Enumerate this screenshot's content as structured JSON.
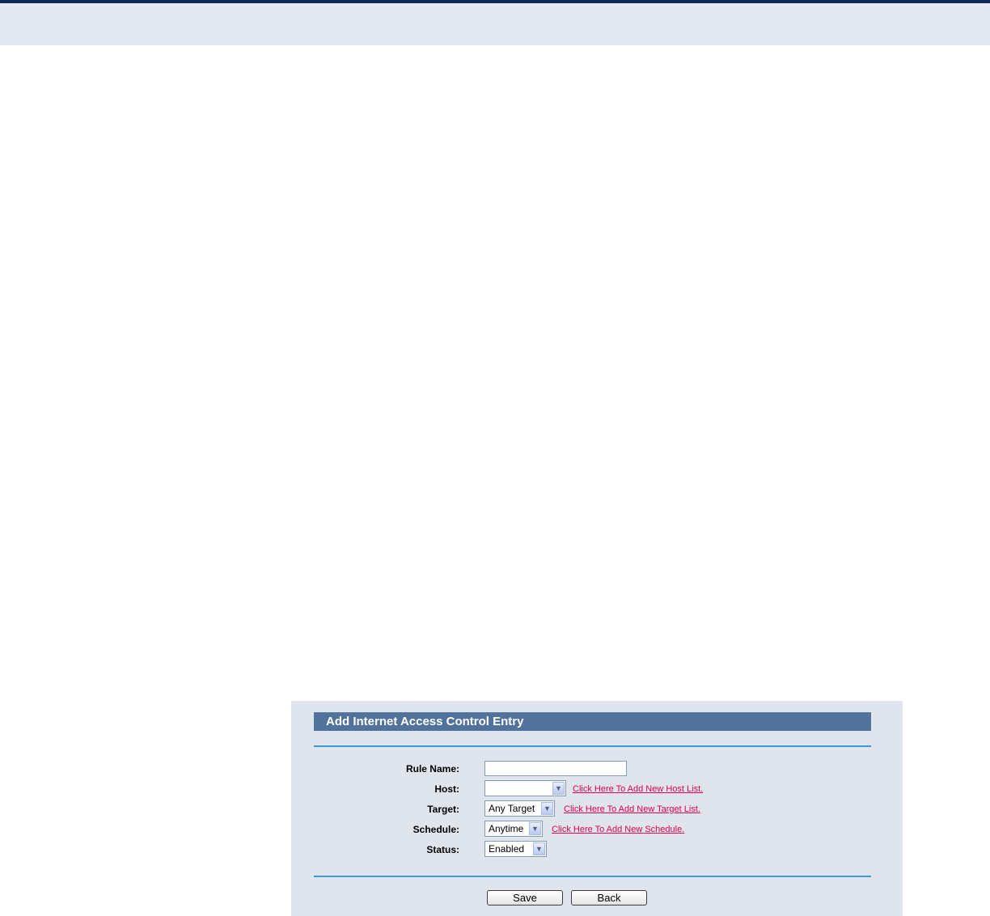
{
  "form": {
    "title": "Add Internet Access Control Entry",
    "fields": {
      "rule_name": {
        "label": "Rule Name:",
        "value": ""
      },
      "host": {
        "label": "Host:",
        "value": "",
        "link": "Click Here To Add New Host List."
      },
      "target": {
        "label": "Target:",
        "value": "Any Target",
        "link": "Click Here To Add New Target List."
      },
      "schedule": {
        "label": "Schedule:",
        "value": "Anytime",
        "link": "Click Here To Add New Schedule."
      },
      "status": {
        "label": "Status:",
        "value": "Enabled"
      }
    },
    "buttons": {
      "save": "Save",
      "back": "Back"
    }
  },
  "colors": {
    "title_bar": "#51739b",
    "panel_bg": "#dfe4ed",
    "rule_line": "#3b9ad6",
    "link": "#e0004a"
  },
  "icons": {
    "dropdown": "chevron-down-icon"
  }
}
